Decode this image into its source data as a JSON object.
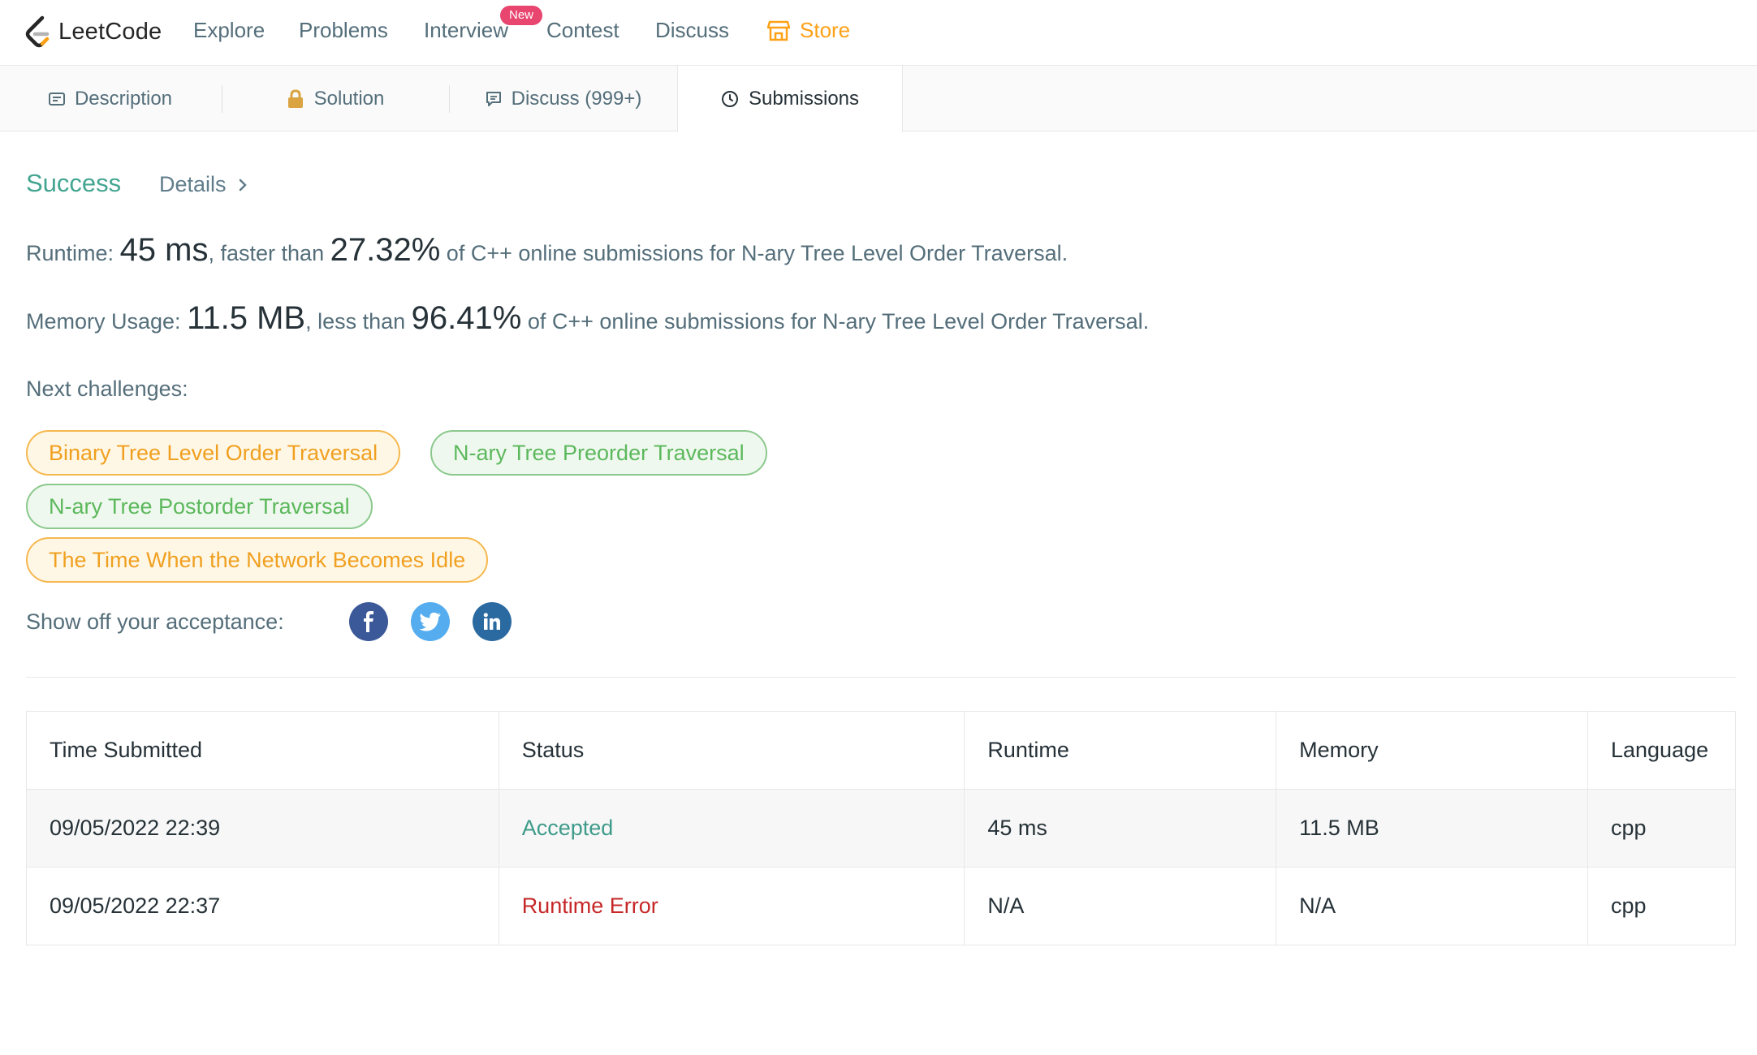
{
  "nav": {
    "logo_text": "LeetCode",
    "items": [
      "Explore",
      "Problems",
      "Interview",
      "Contest",
      "Discuss"
    ],
    "new_badge": "New",
    "store": "Store"
  },
  "tabs": {
    "description": "Description",
    "solution": "Solution",
    "discuss": "Discuss (999+)",
    "submissions": "Submissions"
  },
  "result": {
    "status": "Success",
    "details": "Details"
  },
  "runtime": {
    "label": "Runtime:",
    "value": "45 ms",
    "compare_text": ", faster than",
    "percent": "27.32%",
    "suffix": "of C++ online submissions for N-ary Tree Level Order Traversal."
  },
  "memory": {
    "label": "Memory Usage:",
    "value": "11.5 MB",
    "compare_text": ", less than",
    "percent": "96.41%",
    "suffix": "of C++ online submissions for N-ary Tree Level Order Traversal."
  },
  "next_challenges": {
    "title": "Next challenges:",
    "items": [
      {
        "label": "Binary Tree Level Order Traversal",
        "difficulty": "medium"
      },
      {
        "label": "N-ary Tree Preorder Traversal",
        "difficulty": "easy"
      },
      {
        "label": "N-ary Tree Postorder Traversal",
        "difficulty": "easy"
      },
      {
        "label": "The Time When the Network Becomes Idle",
        "difficulty": "medium"
      }
    ]
  },
  "share": {
    "label": "Show off your acceptance:",
    "icons": [
      "facebook-icon",
      "twitter-icon",
      "linkedin-icon"
    ]
  },
  "table": {
    "headers": [
      "Time Submitted",
      "Status",
      "Runtime",
      "Memory",
      "Language"
    ],
    "rows": [
      {
        "time": "09/05/2022 22:39",
        "status": "Accepted",
        "runtime": "45 ms",
        "memory": "11.5 MB",
        "language": "cpp"
      },
      {
        "time": "09/05/2022 22:37",
        "status": "Runtime Error",
        "runtime": "N/A",
        "memory": "N/A",
        "language": "cpp"
      }
    ]
  },
  "colors": {
    "accent": "#ffa116",
    "success": "#43a591",
    "error": "#c62828",
    "facebook": "#3b5998",
    "twitter": "#55acee",
    "linkedin": "#2b6aa0"
  }
}
